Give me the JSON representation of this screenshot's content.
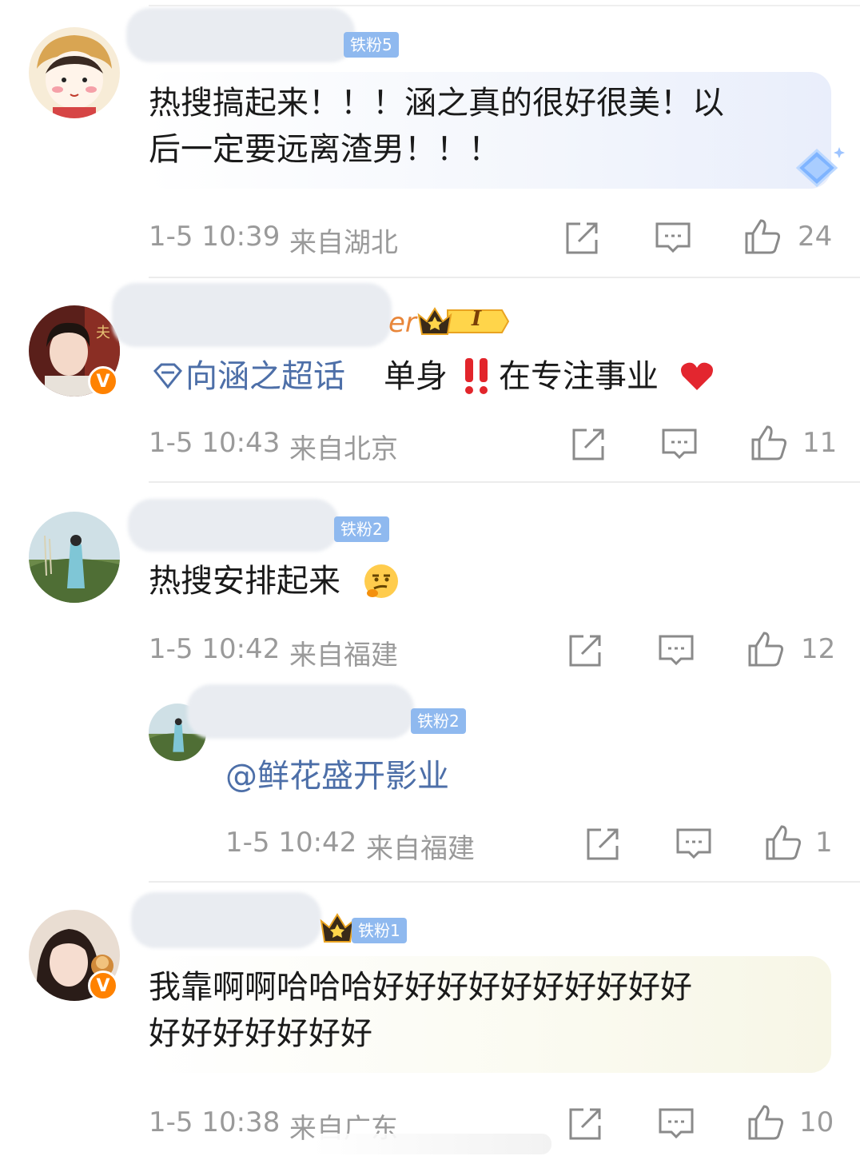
{
  "comments": [
    {
      "fan_badge": "铁粉5",
      "text_line1": "热搜搞起来！！！涵之真的很好很美！以",
      "text_line2": "后一定要远离渣男！！！",
      "time": "1-5 10:39",
      "location": "来自湖北",
      "likes": "24"
    },
    {
      "name_tail": "er",
      "level_badge": "I",
      "topic": "向涵之超话",
      "text": "单身",
      "text_after": "在专注事业",
      "time": "1-5 10:43",
      "location": "来自北京",
      "likes": "11"
    },
    {
      "fan_badge": "铁粉2",
      "text": "热搜安排起来",
      "time": "1-5 10:42",
      "location": "来自福建",
      "likes": "12"
    },
    {
      "fan_badge": "铁粉2",
      "text": "@鲜花盛开影业",
      "time": "1-5 10:42",
      "location": "来自福建",
      "likes": "1"
    },
    {
      "fan_badge": "铁粉1",
      "text_line1": "我靠啊啊哈哈哈好好好好好好好好好好",
      "text_line2": "好好好好好好好",
      "time": "1-5 10:38",
      "location": "来自广东",
      "likes": "10"
    }
  ],
  "verified_mark": "V",
  "colors": {
    "fan_badge": "#8fb9ef",
    "link": "#4d6fa8",
    "verified": "#ff8200",
    "meta": "#9a9a9a"
  }
}
